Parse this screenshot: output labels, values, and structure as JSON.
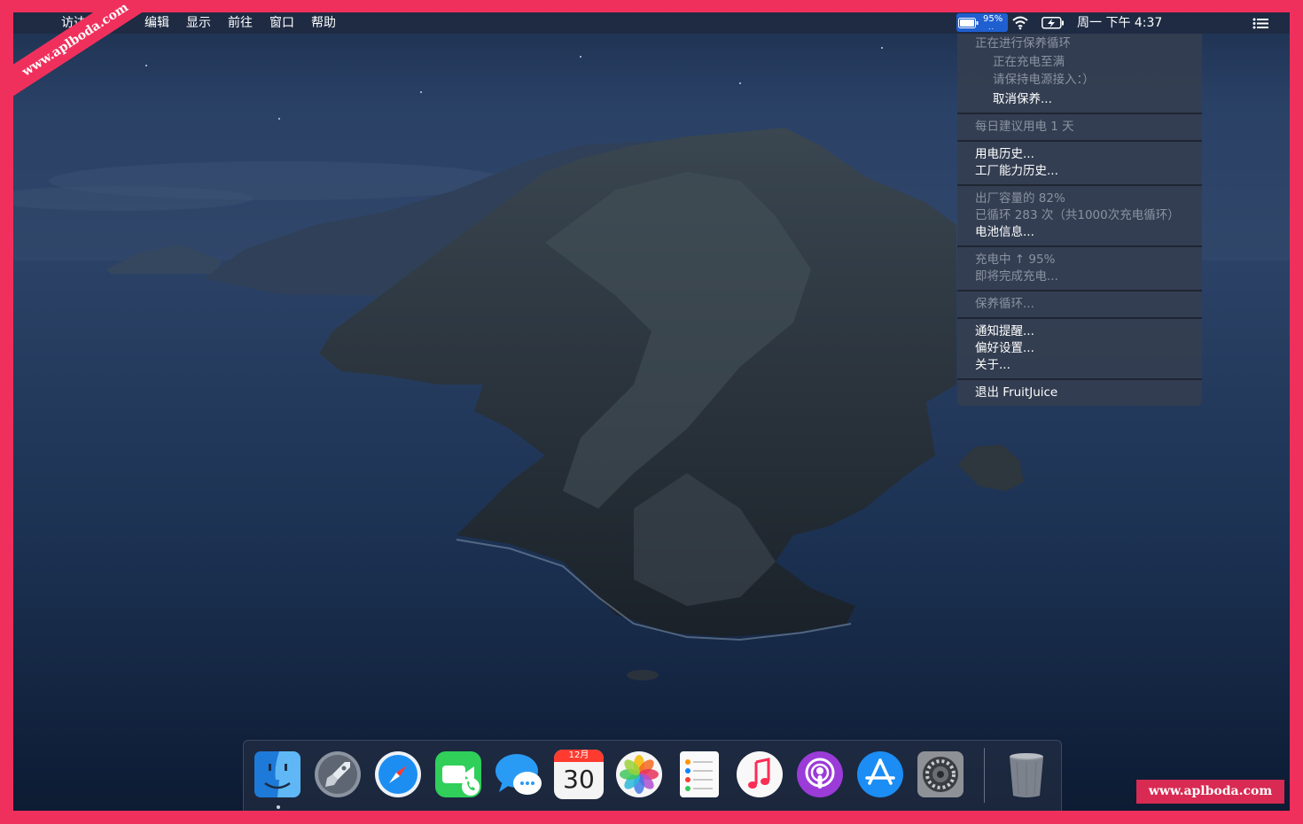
{
  "menubar": {
    "apple_glyph": "",
    "items": [
      "访达",
      "编辑",
      "显示",
      "前往",
      "窗口",
      "帮助"
    ],
    "battery_percent": "95%",
    "battery_dots": "..",
    "clock": "周一 下午 4:37"
  },
  "battery_menu": {
    "maintenance_title": "正在进行保养循环",
    "charging_to_full": "正在充电至满",
    "keep_plugged": "请保持电源接入：）",
    "cancel_maintenance": "取消保养...",
    "daily_advice": "每日建议用电 1 天",
    "usage_history": "用电历史...",
    "capacity_history": "工厂能力历史...",
    "capacity": "出厂容量的 82%",
    "cycles": "已循环 283 次（共1000次充电循环）",
    "battery_info": "电池信息...",
    "charging_status": "充电中 ↑ 95%",
    "almost_full": "即将完成充电...",
    "maintenance_cycle": "保养循环...",
    "notifications": "通知提醒...",
    "preferences": "偏好设置...",
    "about": "关于...",
    "quit": "退出 FruitJuice"
  },
  "dock": {
    "apps": [
      "Finder",
      "Launchpad",
      "Safari",
      "FaceTime",
      "Messages",
      "Calendar",
      "Photos",
      "Reminders",
      "Music",
      "Podcasts",
      "App Store",
      "System Preferences",
      "Trash"
    ],
    "calendar_month": "12月",
    "calendar_day": "30"
  },
  "watermarks": {
    "top_left": "www.aplboda.com",
    "bottom_right": "www.aplboda.com"
  },
  "colors": {
    "frame": "#f0305c",
    "battery_highlight": "#1f5fd0",
    "menu_background": "#343e50"
  }
}
